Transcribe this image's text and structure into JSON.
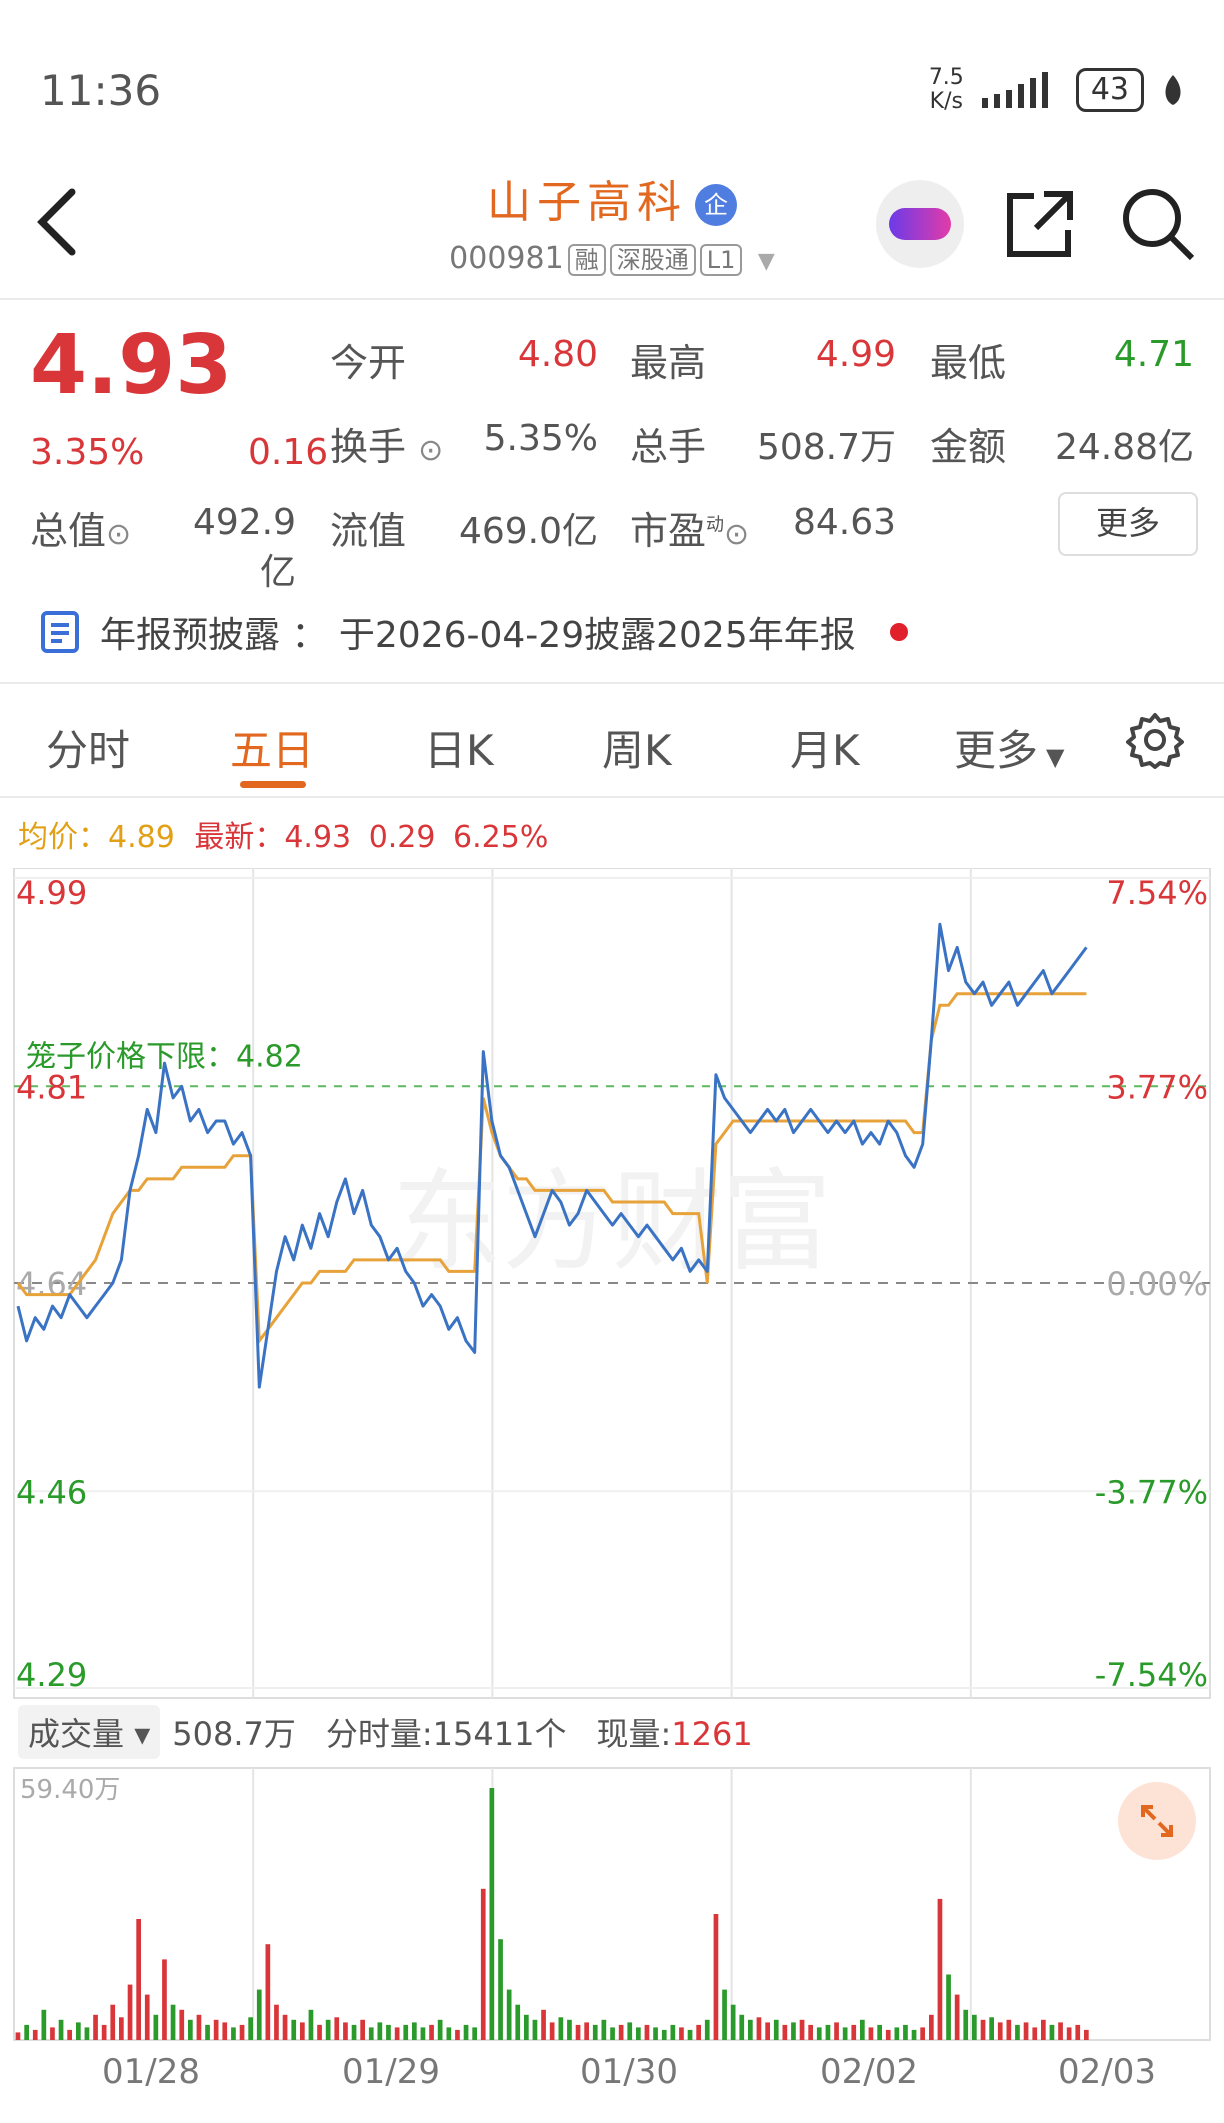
{
  "status": {
    "time": "11:36",
    "net_speed": "7.5\nK/s",
    "battery": "43"
  },
  "header": {
    "title": "山子高科",
    "badge": "企",
    "code": "000981",
    "tags": [
      "融",
      "深股通",
      "L1"
    ]
  },
  "quote": {
    "price": "4.93",
    "change_pct": "3.35%",
    "change": "0.16",
    "open_label": "今开",
    "open": "4.80",
    "high_label": "最高",
    "high": "4.99",
    "low_label": "最低",
    "low": "4.71",
    "turnover_label": "换手",
    "turnover": "5.35%",
    "volume_label": "总手",
    "volume": "508.7万",
    "amount_label": "金额",
    "amount": "24.88亿",
    "mktcap_label": "总值",
    "mktcap": "492.9亿",
    "float_label": "流值",
    "float": "469.0亿",
    "pe_label": "市盈",
    "pe_sup": "动",
    "pe": "84.63",
    "more": "更多"
  },
  "notice": {
    "text": "年报预披露 ： 于2026-04-29披露2025年年报"
  },
  "tabs": {
    "t1": "分时",
    "t2": "五日",
    "t3": "日K",
    "t4": "周K",
    "t5": "月K",
    "t6": "更多"
  },
  "legend": {
    "avg_label": "均价：",
    "avg": "4.89",
    "latest_label": "最新：",
    "latest": "4.93",
    "chg": "0.29",
    "pct": "6.25%"
  },
  "chart_data": {
    "type": "line",
    "title": "",
    "y_left_ticks": [
      "4.99",
      "4.81",
      "4.64",
      "4.46",
      "4.29"
    ],
    "y_right_ticks": [
      "7.54%",
      "3.77%",
      "0.00%",
      "-3.77%",
      "-7.54%"
    ],
    "ylim": [
      4.29,
      4.99
    ],
    "prev_close": 4.64,
    "limit_line_label": "笼子价格下限：4.82",
    "watermark": "东方财富",
    "categories": [
      "01/28",
      "01/29",
      "01/30",
      "02/02",
      "02/03"
    ],
    "series": [
      {
        "name": "",
        "values": [
          4.62,
          4.59,
          4.61,
          4.6,
          4.62,
          4.61,
          4.63,
          4.62,
          4.61,
          4.62,
          4.63,
          4.64,
          4.66,
          4.72,
          4.75,
          4.79,
          4.77,
          4.83,
          4.8,
          4.81,
          4.78,
          4.79,
          4.77,
          4.78,
          4.78,
          4.76,
          4.77,
          4.75,
          4.55,
          4.6,
          4.65,
          4.68,
          4.66,
          4.69,
          4.67,
          4.7,
          4.68,
          4.71,
          4.73,
          4.7,
          4.72,
          4.69,
          4.68,
          4.66,
          4.67,
          4.65,
          4.64,
          4.62,
          4.63,
          4.62,
          4.6,
          4.61,
          4.59,
          4.58,
          4.84,
          4.78,
          4.75,
          4.74,
          4.72,
          4.7,
          4.68,
          4.7,
          4.72,
          4.71,
          4.69,
          4.7,
          4.72,
          4.71,
          4.7,
          4.69,
          4.7,
          4.69,
          4.68,
          4.69,
          4.68,
          4.67,
          4.66,
          4.67,
          4.65,
          4.66,
          4.65,
          4.82,
          4.8,
          4.79,
          4.78,
          4.77,
          4.78,
          4.79,
          4.78,
          4.79,
          4.77,
          4.78,
          4.79,
          4.78,
          4.77,
          4.78,
          4.77,
          4.78,
          4.76,
          4.77,
          4.76,
          4.78,
          4.77,
          4.75,
          4.74,
          4.76,
          4.85,
          4.95,
          4.91,
          4.93,
          4.9,
          4.89,
          4.9,
          4.88,
          4.89,
          4.9,
          4.88,
          4.89,
          4.9,
          4.91,
          4.89,
          4.9,
          4.91,
          4.92,
          4.93
        ]
      },
      {
        "name": "",
        "values": [
          4.64,
          4.63,
          4.63,
          4.63,
          4.63,
          4.63,
          4.63,
          4.64,
          4.65,
          4.66,
          4.68,
          4.7,
          4.71,
          4.72,
          4.72,
          4.73,
          4.73,
          4.73,
          4.73,
          4.74,
          4.74,
          4.74,
          4.74,
          4.74,
          4.74,
          4.75,
          4.75,
          4.75,
          4.59,
          4.6,
          4.61,
          4.62,
          4.63,
          4.64,
          4.64,
          4.65,
          4.65,
          4.65,
          4.65,
          4.66,
          4.66,
          4.66,
          4.66,
          4.66,
          4.66,
          4.66,
          4.66,
          4.66,
          4.66,
          4.66,
          4.65,
          4.65,
          4.65,
          4.65,
          4.8,
          4.77,
          4.75,
          4.74,
          4.73,
          4.73,
          4.72,
          4.72,
          4.72,
          4.72,
          4.72,
          4.72,
          4.72,
          4.72,
          4.72,
          4.71,
          4.71,
          4.71,
          4.71,
          4.71,
          4.71,
          4.71,
          4.7,
          4.7,
          4.7,
          4.7,
          4.64,
          4.76,
          4.77,
          4.78,
          4.78,
          4.78,
          4.78,
          4.78,
          4.78,
          4.78,
          4.78,
          4.78,
          4.78,
          4.78,
          4.78,
          4.78,
          4.78,
          4.78,
          4.78,
          4.78,
          4.78,
          4.78,
          4.78,
          4.78,
          4.77,
          4.77,
          4.85,
          4.88,
          4.88,
          4.89,
          4.89,
          4.89,
          4.89,
          4.89,
          4.89,
          4.89,
          4.89,
          4.89,
          4.89,
          4.89,
          4.89,
          4.89,
          4.89,
          4.89,
          4.89
        ]
      }
    ],
    "volume": {
      "max_label": "59.40万",
      "values": [
        3,
        6,
        4,
        12,
        5,
        8,
        4,
        7,
        5,
        10,
        6,
        14,
        9,
        22,
        48,
        18,
        10,
        32,
        14,
        12,
        8,
        10,
        6,
        8,
        7,
        5,
        6,
        9,
        20,
        38,
        14,
        10,
        8,
        7,
        12,
        6,
        8,
        9,
        7,
        6,
        8,
        5,
        7,
        6,
        5,
        6,
        7,
        5,
        6,
        8,
        5,
        4,
        6,
        5,
        60,
        100,
        40,
        20,
        14,
        10,
        8,
        12,
        7,
        9,
        8,
        6,
        7,
        6,
        8,
        5,
        6,
        7,
        5,
        6,
        5,
        4,
        6,
        5,
        4,
        6,
        8,
        50,
        20,
        14,
        10,
        8,
        9,
        7,
        8,
        6,
        7,
        8,
        6,
        5,
        6,
        7,
        5,
        6,
        8,
        5,
        6,
        4,
        5,
        6,
        4,
        5,
        10,
        56,
        26,
        18,
        12,
        10,
        8,
        9,
        7,
        8,
        6,
        7,
        5,
        8,
        6,
        7,
        5,
        6,
        4
      ]
    }
  },
  "volume_bar": {
    "label": "成交量",
    "total": "508.7万",
    "minute_label": "分时量:",
    "minute": "15411个",
    "current_label": "现量:",
    "current": "1261"
  }
}
